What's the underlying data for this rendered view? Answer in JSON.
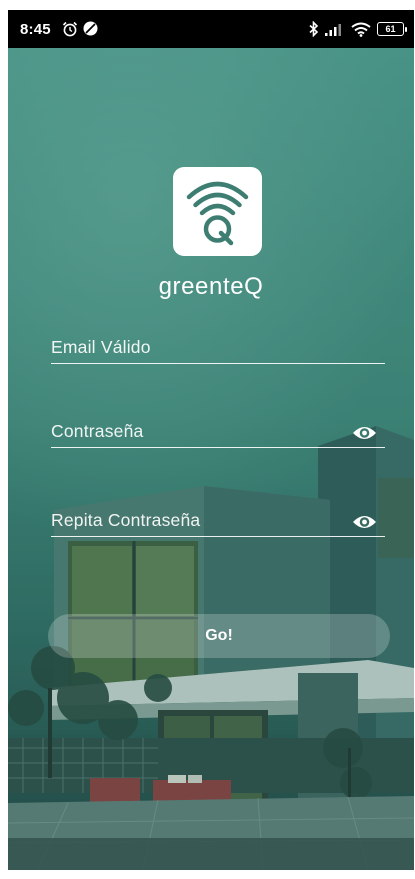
{
  "status_bar": {
    "time": "8:45",
    "battery": "61",
    "icons": [
      "alarm-icon",
      "do-not-disturb-icon",
      "bluetooth-icon",
      "signal-icon",
      "wifi-icon",
      "battery-icon"
    ]
  },
  "brand": {
    "name": "greenteQ",
    "logo_icon": "wifi-q-logo-icon"
  },
  "form": {
    "email_placeholder": "Email Válido",
    "password_placeholder": "Contraseña",
    "repeat_password_placeholder": "Repita Contraseña",
    "submit_label": "Go!",
    "visibility_icon": "eye-icon"
  },
  "colors": {
    "brand_green": "#3e7e72",
    "overlay_teal": "#2e6e66",
    "text": "#ffffff"
  }
}
